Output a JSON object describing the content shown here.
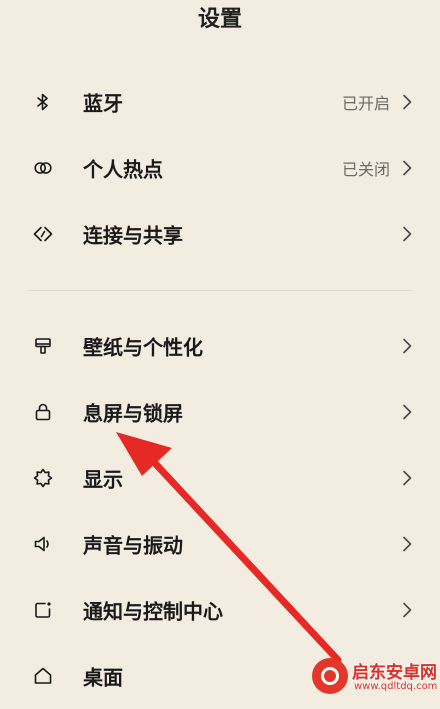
{
  "header": {
    "title": "设置"
  },
  "groups": {
    "connectivity": {
      "bluetooth": {
        "label": "蓝牙",
        "status": "已开启",
        "icon": "bluetooth-icon"
      },
      "hotspot": {
        "label": "个人热点",
        "status": "已关闭",
        "icon": "hotspot-icon"
      },
      "sharing": {
        "label": "连接与共享",
        "icon": "share-connect-icon"
      }
    },
    "personalization": {
      "wallpaper": {
        "label": "壁纸与个性化",
        "icon": "paint-brush-icon"
      },
      "lockscreen": {
        "label": "息屏与锁屏",
        "icon": "lock-icon"
      },
      "display": {
        "label": "显示",
        "icon": "sun-icon"
      },
      "sound": {
        "label": "声音与振动",
        "icon": "speaker-icon"
      },
      "notifications": {
        "label": "通知与控制中心",
        "icon": "notification-icon"
      },
      "desktop": {
        "label": "桌面",
        "icon": "home-icon"
      }
    }
  },
  "annotation": {
    "arrow_color": "#e52a26",
    "points_to": "lockscreen"
  },
  "watermark": {
    "title": "启东安卓网",
    "url": "www.qdltdq.com"
  }
}
